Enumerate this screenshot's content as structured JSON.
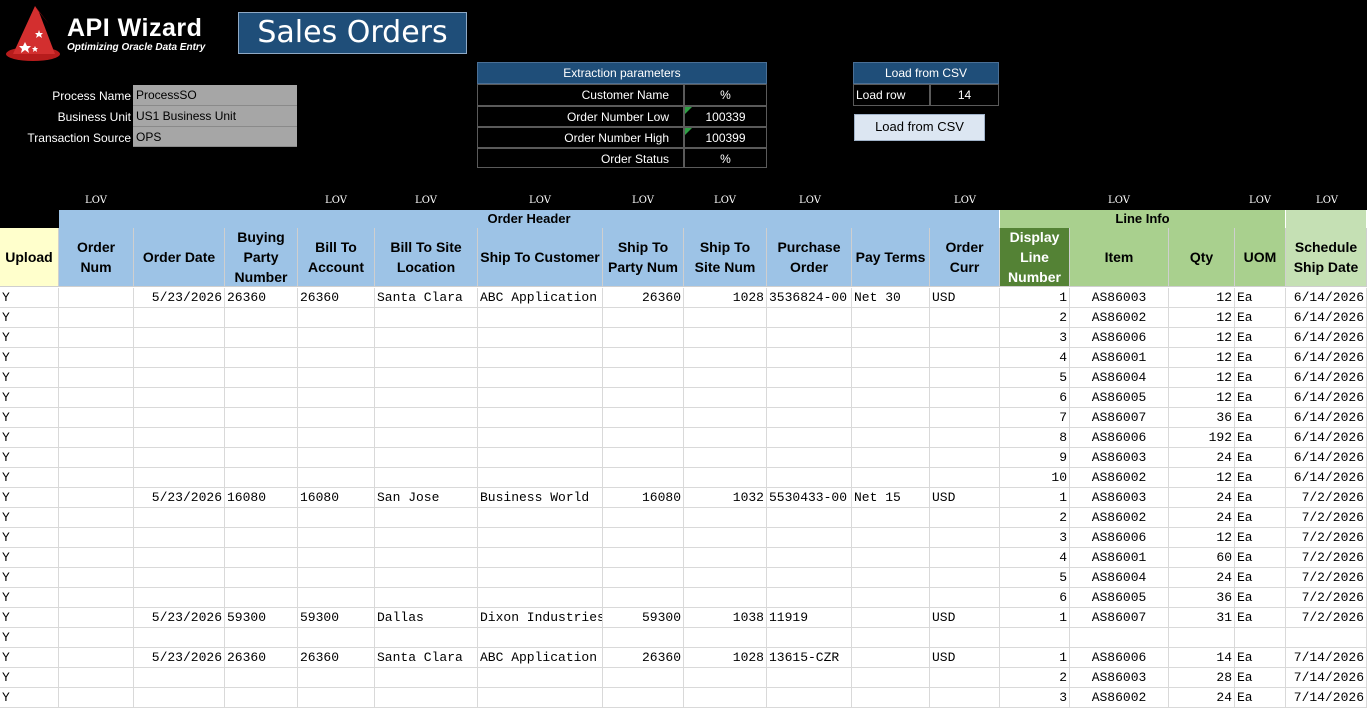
{
  "app": {
    "logo_title": "API Wizard",
    "logo_subtitle": "Optimizing Oracle Data Entry",
    "sheet_title": "Sales Orders"
  },
  "process": {
    "process_name_label": "Process Name",
    "process_name_value": "ProcessSO",
    "business_unit_label": "Business Unit",
    "business_unit_value": "US1 Business Unit",
    "transaction_source_label": "Transaction Source",
    "transaction_source_value": "OPS"
  },
  "extraction": {
    "title": "Extraction parameters",
    "params": [
      {
        "label": "Customer Name",
        "value": "%"
      },
      {
        "label": "Order Number Low",
        "value": "100339"
      },
      {
        "label": "Order Number High",
        "value": "100399"
      },
      {
        "label": "Order Status",
        "value": "%"
      }
    ]
  },
  "csv": {
    "title": "Load from CSV",
    "load_row_label": "Load row",
    "load_row_value": "14",
    "button_label": "Load from CSV"
  },
  "lov_label": "LOV",
  "groups": {
    "order_header": "Order Header",
    "line_info": "Line Info"
  },
  "columns": {
    "upload": "Upload",
    "order_num": "Order Num",
    "order_date": "Order Date",
    "buying_party": "Buying Party Number",
    "bill_to_account": "Bill To Account",
    "bill_to_site": "Bill To Site Location",
    "ship_to_customer": "Ship To Customer",
    "ship_to_party": "Ship To Party Num",
    "ship_to_site": "Ship To Site Num",
    "purchase_order": "Purchase Order",
    "pay_terms": "Pay Terms",
    "order_curr": "Order Curr",
    "display_line": "Display Line Number",
    "item": "Item",
    "qty": "Qty",
    "uom": "UOM",
    "schedule_ship": "Schedule Ship Date"
  },
  "colors": {
    "header_blue": "#9dc3e6",
    "group_blue": "#9dc3e6",
    "line_green": "#a9d08e",
    "display_line_green": "#548235",
    "upload_yellow": "#ffffcc",
    "title_blue": "#1f4e79"
  },
  "rows": [
    {
      "upload": "Y",
      "order_num": "",
      "order_date": "5/23/2026",
      "buying_party": "26360",
      "bill_to_account": "26360",
      "bill_to_site": "Santa Clara",
      "ship_to_customer": "ABC Application",
      "ship_to_party": "26360",
      "ship_to_site": "1028",
      "purchase_order": "3536824-00",
      "pay_terms": "Net 30",
      "order_curr": "USD",
      "display_line": "1",
      "item": "AS86003",
      "qty": "12",
      "uom": "Ea",
      "schedule_ship": "6/14/2026"
    },
    {
      "upload": "Y",
      "order_num": "",
      "order_date": "",
      "buying_party": "",
      "bill_to_account": "",
      "bill_to_site": "",
      "ship_to_customer": "",
      "ship_to_party": "",
      "ship_to_site": "",
      "purchase_order": "",
      "pay_terms": "",
      "order_curr": "",
      "display_line": "2",
      "item": "AS86002",
      "qty": "12",
      "uom": "Ea",
      "schedule_ship": "6/14/2026"
    },
    {
      "upload": "Y",
      "order_num": "",
      "order_date": "",
      "buying_party": "",
      "bill_to_account": "",
      "bill_to_site": "",
      "ship_to_customer": "",
      "ship_to_party": "",
      "ship_to_site": "",
      "purchase_order": "",
      "pay_terms": "",
      "order_curr": "",
      "display_line": "3",
      "item": "AS86006",
      "qty": "12",
      "uom": "Ea",
      "schedule_ship": "6/14/2026"
    },
    {
      "upload": "Y",
      "order_num": "",
      "order_date": "",
      "buying_party": "",
      "bill_to_account": "",
      "bill_to_site": "",
      "ship_to_customer": "",
      "ship_to_party": "",
      "ship_to_site": "",
      "purchase_order": "",
      "pay_terms": "",
      "order_curr": "",
      "display_line": "4",
      "item": "AS86001",
      "qty": "12",
      "uom": "Ea",
      "schedule_ship": "6/14/2026"
    },
    {
      "upload": "Y",
      "order_num": "",
      "order_date": "",
      "buying_party": "",
      "bill_to_account": "",
      "bill_to_site": "",
      "ship_to_customer": "",
      "ship_to_party": "",
      "ship_to_site": "",
      "purchase_order": "",
      "pay_terms": "",
      "order_curr": "",
      "display_line": "5",
      "item": "AS86004",
      "qty": "12",
      "uom": "Ea",
      "schedule_ship": "6/14/2026"
    },
    {
      "upload": "Y",
      "order_num": "",
      "order_date": "",
      "buying_party": "",
      "bill_to_account": "",
      "bill_to_site": "",
      "ship_to_customer": "",
      "ship_to_party": "",
      "ship_to_site": "",
      "purchase_order": "",
      "pay_terms": "",
      "order_curr": "",
      "display_line": "6",
      "item": "AS86005",
      "qty": "12",
      "uom": "Ea",
      "schedule_ship": "6/14/2026"
    },
    {
      "upload": "Y",
      "order_num": "",
      "order_date": "",
      "buying_party": "",
      "bill_to_account": "",
      "bill_to_site": "",
      "ship_to_customer": "",
      "ship_to_party": "",
      "ship_to_site": "",
      "purchase_order": "",
      "pay_terms": "",
      "order_curr": "",
      "display_line": "7",
      "item": "AS86007",
      "qty": "36",
      "uom": "Ea",
      "schedule_ship": "6/14/2026"
    },
    {
      "upload": "Y",
      "order_num": "",
      "order_date": "",
      "buying_party": "",
      "bill_to_account": "",
      "bill_to_site": "",
      "ship_to_customer": "",
      "ship_to_party": "",
      "ship_to_site": "",
      "purchase_order": "",
      "pay_terms": "",
      "order_curr": "",
      "display_line": "8",
      "item": "AS86006",
      "qty": "192",
      "uom": "Ea",
      "schedule_ship": "6/14/2026"
    },
    {
      "upload": "Y",
      "order_num": "",
      "order_date": "",
      "buying_party": "",
      "bill_to_account": "",
      "bill_to_site": "",
      "ship_to_customer": "",
      "ship_to_party": "",
      "ship_to_site": "",
      "purchase_order": "",
      "pay_terms": "",
      "order_curr": "",
      "display_line": "9",
      "item": "AS86003",
      "qty": "24",
      "uom": "Ea",
      "schedule_ship": "6/14/2026"
    },
    {
      "upload": "Y",
      "order_num": "",
      "order_date": "",
      "buying_party": "",
      "bill_to_account": "",
      "bill_to_site": "",
      "ship_to_customer": "",
      "ship_to_party": "",
      "ship_to_site": "",
      "purchase_order": "",
      "pay_terms": "",
      "order_curr": "",
      "display_line": "10",
      "item": "AS86002",
      "qty": "12",
      "uom": "Ea",
      "schedule_ship": "6/14/2026"
    },
    {
      "upload": "Y",
      "order_num": "",
      "order_date": "5/23/2026",
      "buying_party": "16080",
      "bill_to_account": "16080",
      "bill_to_site": "San Jose",
      "ship_to_customer": "Business World",
      "ship_to_party": "16080",
      "ship_to_site": "1032",
      "purchase_order": "5530433-00",
      "pay_terms": "Net 15",
      "order_curr": "USD",
      "display_line": "1",
      "item": "AS86003",
      "qty": "24",
      "uom": "Ea",
      "schedule_ship": "7/2/2026"
    },
    {
      "upload": "Y",
      "order_num": "",
      "order_date": "",
      "buying_party": "",
      "bill_to_account": "",
      "bill_to_site": "",
      "ship_to_customer": "",
      "ship_to_party": "",
      "ship_to_site": "",
      "purchase_order": "",
      "pay_terms": "",
      "order_curr": "",
      "display_line": "2",
      "item": "AS86002",
      "qty": "24",
      "uom": "Ea",
      "schedule_ship": "7/2/2026"
    },
    {
      "upload": "Y",
      "order_num": "",
      "order_date": "",
      "buying_party": "",
      "bill_to_account": "",
      "bill_to_site": "",
      "ship_to_customer": "",
      "ship_to_party": "",
      "ship_to_site": "",
      "purchase_order": "",
      "pay_terms": "",
      "order_curr": "",
      "display_line": "3",
      "item": "AS86006",
      "qty": "12",
      "uom": "Ea",
      "schedule_ship": "7/2/2026"
    },
    {
      "upload": "Y",
      "order_num": "",
      "order_date": "",
      "buying_party": "",
      "bill_to_account": "",
      "bill_to_site": "",
      "ship_to_customer": "",
      "ship_to_party": "",
      "ship_to_site": "",
      "purchase_order": "",
      "pay_terms": "",
      "order_curr": "",
      "display_line": "4",
      "item": "AS86001",
      "qty": "60",
      "uom": "Ea",
      "schedule_ship": "7/2/2026"
    },
    {
      "upload": "Y",
      "order_num": "",
      "order_date": "",
      "buying_party": "",
      "bill_to_account": "",
      "bill_to_site": "",
      "ship_to_customer": "",
      "ship_to_party": "",
      "ship_to_site": "",
      "purchase_order": "",
      "pay_terms": "",
      "order_curr": "",
      "display_line": "5",
      "item": "AS86004",
      "qty": "24",
      "uom": "Ea",
      "schedule_ship": "7/2/2026"
    },
    {
      "upload": "Y",
      "order_num": "",
      "order_date": "",
      "buying_party": "",
      "bill_to_account": "",
      "bill_to_site": "",
      "ship_to_customer": "",
      "ship_to_party": "",
      "ship_to_site": "",
      "purchase_order": "",
      "pay_terms": "",
      "order_curr": "",
      "display_line": "6",
      "item": "AS86005",
      "qty": "36",
      "uom": "Ea",
      "schedule_ship": "7/2/2026"
    },
    {
      "upload": "Y",
      "order_num": "",
      "order_date": "5/23/2026",
      "buying_party": "59300",
      "bill_to_account": "59300",
      "bill_to_site": "Dallas",
      "ship_to_customer": "Dixon Industries",
      "ship_to_party": "59300",
      "ship_to_site": "1038",
      "purchase_order": "11919",
      "pay_terms": "",
      "order_curr": "USD",
      "display_line": "1",
      "item": "AS86007",
      "qty": "31",
      "uom": "Ea",
      "schedule_ship": "7/2/2026"
    },
    {
      "upload": "Y",
      "order_num": "",
      "order_date": "",
      "buying_party": "",
      "bill_to_account": "",
      "bill_to_site": "",
      "ship_to_customer": "",
      "ship_to_party": "",
      "ship_to_site": "",
      "purchase_order": "",
      "pay_terms": "",
      "order_curr": "",
      "display_line": "",
      "item": "",
      "qty": "",
      "uom": "",
      "schedule_ship": ""
    },
    {
      "upload": "Y",
      "order_num": "",
      "order_date": "5/23/2026",
      "buying_party": "26360",
      "bill_to_account": "26360",
      "bill_to_site": "Santa Clara",
      "ship_to_customer": "ABC Application",
      "ship_to_party": "26360",
      "ship_to_site": "1028",
      "purchase_order": "13615-CZR",
      "pay_terms": "",
      "order_curr": "USD",
      "display_line": "1",
      "item": "AS86006",
      "qty": "14",
      "uom": "Ea",
      "schedule_ship": "7/14/2026"
    },
    {
      "upload": "Y",
      "order_num": "",
      "order_date": "",
      "buying_party": "",
      "bill_to_account": "",
      "bill_to_site": "",
      "ship_to_customer": "",
      "ship_to_party": "",
      "ship_to_site": "",
      "purchase_order": "",
      "pay_terms": "",
      "order_curr": "",
      "display_line": "2",
      "item": "AS86003",
      "qty": "28",
      "uom": "Ea",
      "schedule_ship": "7/14/2026"
    },
    {
      "upload": "Y",
      "order_num": "",
      "order_date": "",
      "buying_party": "",
      "bill_to_account": "",
      "bill_to_site": "",
      "ship_to_customer": "",
      "ship_to_party": "",
      "ship_to_site": "",
      "purchase_order": "",
      "pay_terms": "",
      "order_curr": "",
      "display_line": "3",
      "item": "AS86002",
      "qty": "24",
      "uom": "Ea",
      "schedule_ship": "7/14/2026"
    }
  ]
}
